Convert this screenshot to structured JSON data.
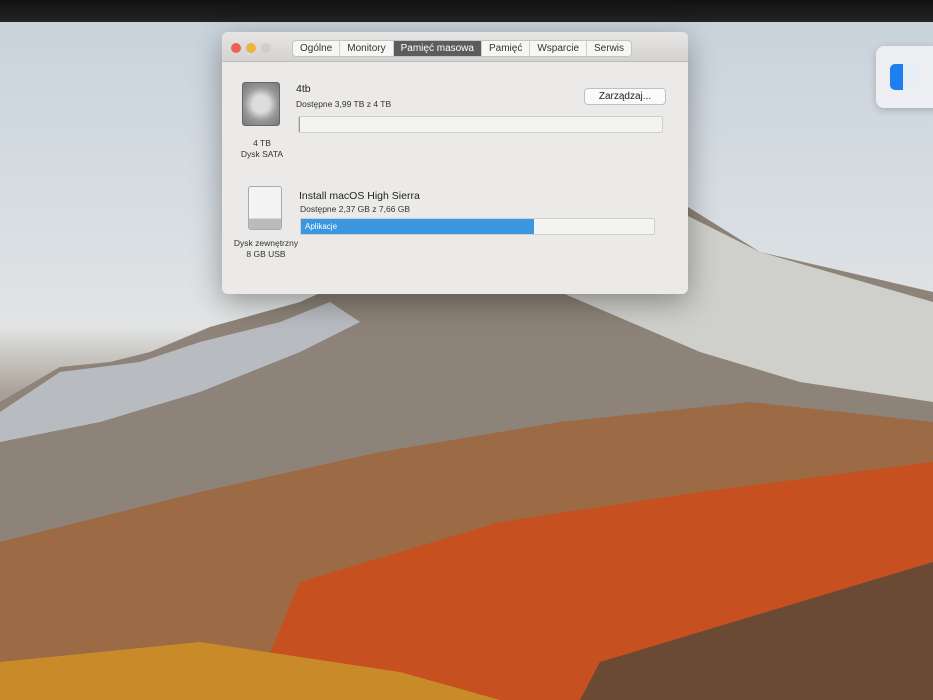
{
  "window": {
    "tabs": [
      "Ogólne",
      "Monitory",
      "Pamięć masowa",
      "Pamięć",
      "Wsparcie",
      "Serwis"
    ],
    "active_tab": "Pamięć masowa",
    "disks": [
      {
        "name": "4tb",
        "available": "Dostępne 3,99 TB z 4 TB",
        "capacity": "4 TB",
        "type": "Dysk SATA",
        "used_fraction": 0.0025,
        "manage_label": "Zarządzaj..."
      },
      {
        "name": "Install macOS High Sierra",
        "available": "Dostępne 2,37 GB z 7,66 GB",
        "capacity": "Dysk zewnętrzny",
        "type": "8 GB USB",
        "used_fraction": 0.66,
        "segment_label": "Aplikacje"
      }
    ]
  },
  "colors": {
    "accent": "#3b97df",
    "close": "#ec5f57",
    "minimize": "#e8b53d"
  }
}
